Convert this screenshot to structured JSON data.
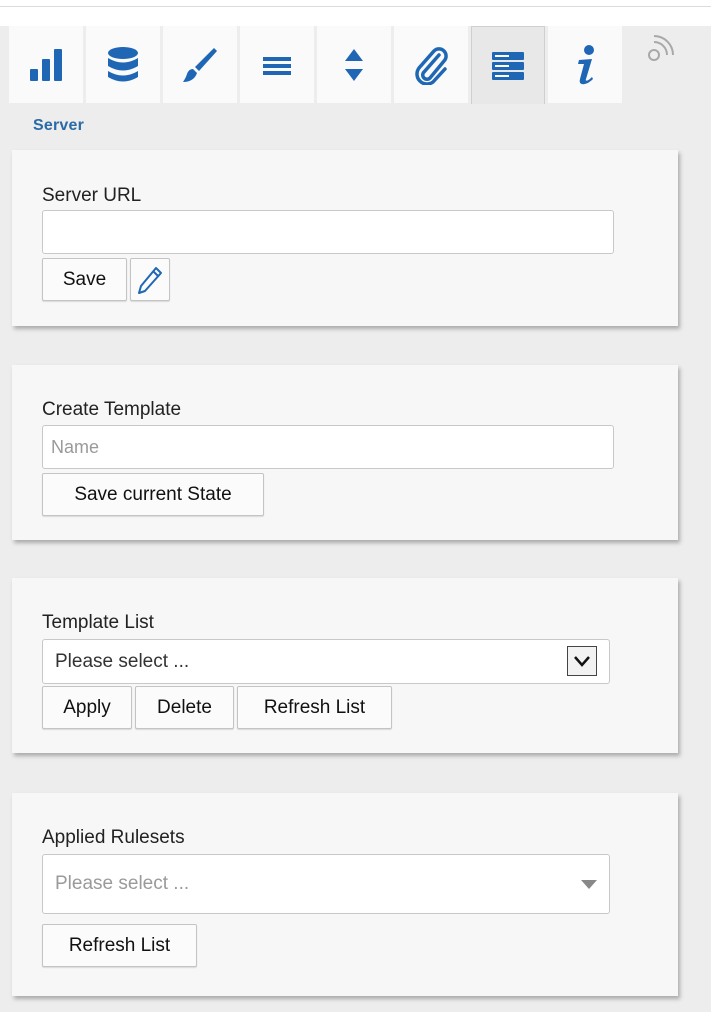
{
  "tabs": [
    {
      "name": "bar-chart-icon",
      "active": false
    },
    {
      "name": "database-icon",
      "active": false
    },
    {
      "name": "brush-icon",
      "active": false
    },
    {
      "name": "menu-lines-icon",
      "active": false
    },
    {
      "name": "sort-arrows-icon",
      "active": false
    },
    {
      "name": "paperclip-icon",
      "active": false
    },
    {
      "name": "server-icon",
      "active": true
    },
    {
      "name": "info-icon",
      "active": false
    }
  ],
  "colors": {
    "accent": "#1f67b5",
    "label_blue": "#2a6aa6"
  },
  "section_title": "Server",
  "server": {
    "label": "Server URL",
    "url_value": "",
    "save_label": "Save"
  },
  "create_template": {
    "label": "Create Template",
    "name_placeholder": "Name",
    "save_state_label": "Save current State"
  },
  "template_list": {
    "label": "Template List",
    "selected": "Please select ...",
    "apply_label": "Apply",
    "delete_label": "Delete",
    "refresh_label": "Refresh List"
  },
  "applied_rulesets": {
    "label": "Applied Rulesets",
    "placeholder": "Please select ...",
    "refresh_label": "Refresh List"
  }
}
